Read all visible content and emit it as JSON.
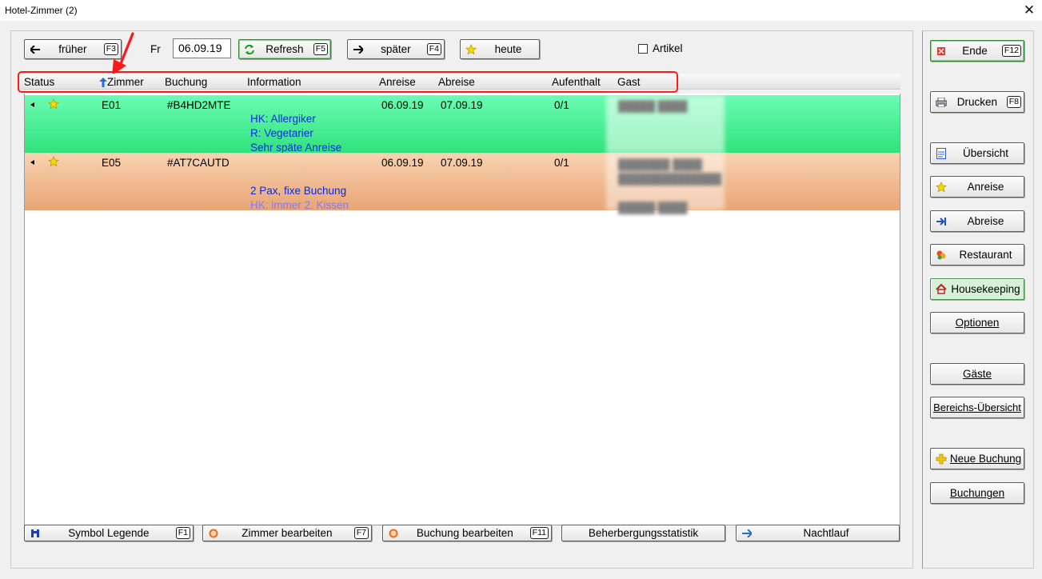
{
  "window": {
    "title": "Hotel-Zimmer (2)",
    "close": "✕"
  },
  "toolbar": {
    "earlier": {
      "label": "früher",
      "key": "F3"
    },
    "day": "Fr",
    "date": "06.09.19",
    "refresh": {
      "label": "Refresh",
      "key": "F5"
    },
    "later": {
      "label": "später",
      "key": "F4"
    },
    "today": {
      "label": "heute"
    },
    "articles": {
      "label": "Artikel",
      "checked": false
    }
  },
  "table": {
    "columns": [
      "Status",
      "Zimmer",
      "Buchung",
      "Information",
      "Anreise",
      "Abreise",
      "Aufenthalt",
      "Gast"
    ],
    "sort_column": "Zimmer",
    "rows": [
      {
        "room": "E01",
        "booking": "#B4HD2MTE",
        "info": [
          "HK: Allergiker",
          "R: Vegetarier",
          "Sehr späte Anreise"
        ],
        "arrival": "06.09.19",
        "departure": "07.09.19",
        "stay": "0/1",
        "color": "#3ef08f"
      },
      {
        "room": "E05",
        "booking": "#AT7CAUTD",
        "info": [
          "",
          "2 Pax, fixe Buchung",
          "HK: immer 2. Kissen"
        ],
        "arrival": "06.09.19",
        "departure": "07.09.19",
        "stay": "0/1",
        "color": "#f0b68a"
      }
    ]
  },
  "bottom_buttons": {
    "legend": {
      "label": "Symbol Legende",
      "key": "F1"
    },
    "edit_room": {
      "label": "Zimmer bearbeiten",
      "key": "F7"
    },
    "edit_booking": {
      "label": "Buchung bearbeiten",
      "key": "F11"
    },
    "statistics": {
      "label": "Beherbergungsstatistik"
    },
    "night_run": {
      "label": "Nachtlauf"
    }
  },
  "side_buttons": {
    "end": {
      "label": "Ende",
      "key": "F12"
    },
    "print": {
      "label": "Drucken",
      "key": "F8"
    },
    "overview": {
      "label": "Übersicht"
    },
    "arrival": {
      "label": "Anreise"
    },
    "departure": {
      "label": "Abreise"
    },
    "restaurant": {
      "label": "Restaurant"
    },
    "housekeeping": {
      "label": "Housekeeping"
    },
    "options": {
      "label": "Optionen"
    },
    "guests": {
      "label": "Gäste"
    },
    "area_overview": {
      "label": "Bereichs-Übersicht"
    },
    "new_booking": {
      "label": "Neue Buchung"
    },
    "bookings": {
      "label": "Buchungen"
    }
  },
  "colors": {
    "annotation": "#ff1818",
    "info_text": "#0c2be0",
    "row_green": "#3ef08f",
    "row_orange": "#f0b68a"
  }
}
